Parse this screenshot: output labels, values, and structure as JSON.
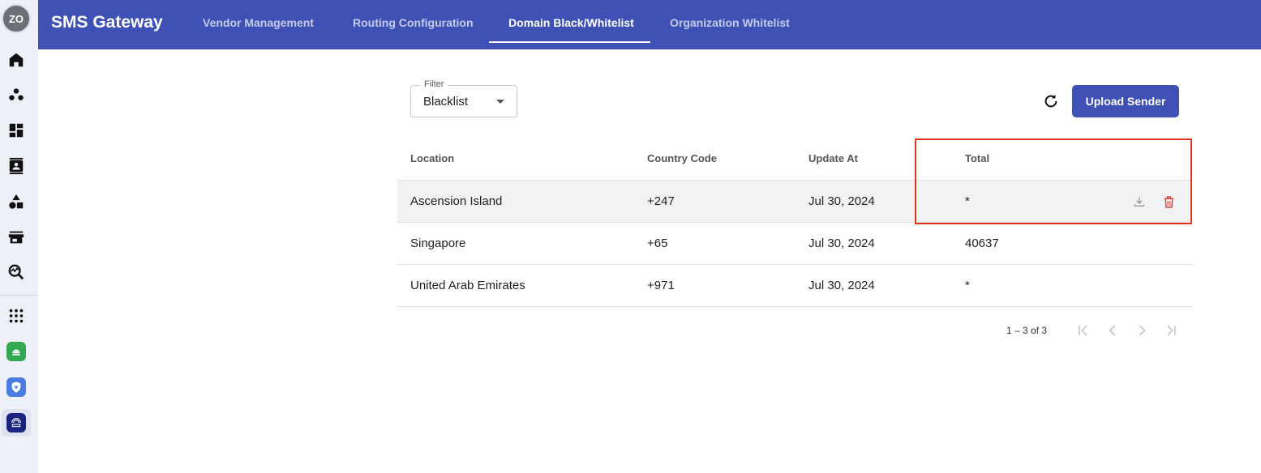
{
  "rail": {
    "avatar": "ZO",
    "icons": [
      "home-icon",
      "group-icon",
      "dashboard-icon",
      "contacts-icon",
      "shapes-icon",
      "store-icon",
      "analytics-search-icon",
      "apps-grid-icon"
    ],
    "apps": [
      "android-app-icon",
      "security-app-icon",
      "network-app-icon"
    ]
  },
  "header": {
    "title": "SMS Gateway",
    "tabs": [
      {
        "label": "Vendor Management"
      },
      {
        "label": "Routing Configuration"
      },
      {
        "label": "Domain Black/Whitelist"
      },
      {
        "label": "Organization Whitelist"
      }
    ],
    "active_tab": "Domain Black/Whitelist",
    "color": "#3f51b5"
  },
  "filter": {
    "label": "Filter",
    "value": "Blacklist"
  },
  "toolbar": {
    "upload_label": "Upload Sender"
  },
  "table": {
    "columns": [
      "Location",
      "Country Code",
      "Update At",
      "Total"
    ],
    "rows": [
      {
        "location": "Ascension Island",
        "country_code": "+247",
        "update_at": "Jul 30, 2024",
        "total": "*"
      },
      {
        "location": "Singapore",
        "country_code": "+65",
        "update_at": "Jul 30, 2024",
        "total": "40637"
      },
      {
        "location": "United Arab Emirates",
        "country_code": "+971",
        "update_at": "Jul 30, 2024",
        "total": "*"
      }
    ]
  },
  "pagination": {
    "range": "1 – 3 of 3"
  },
  "colors": {
    "accent": "#3f51b5",
    "highlight": "#e0341b",
    "delete": "#e53935"
  }
}
